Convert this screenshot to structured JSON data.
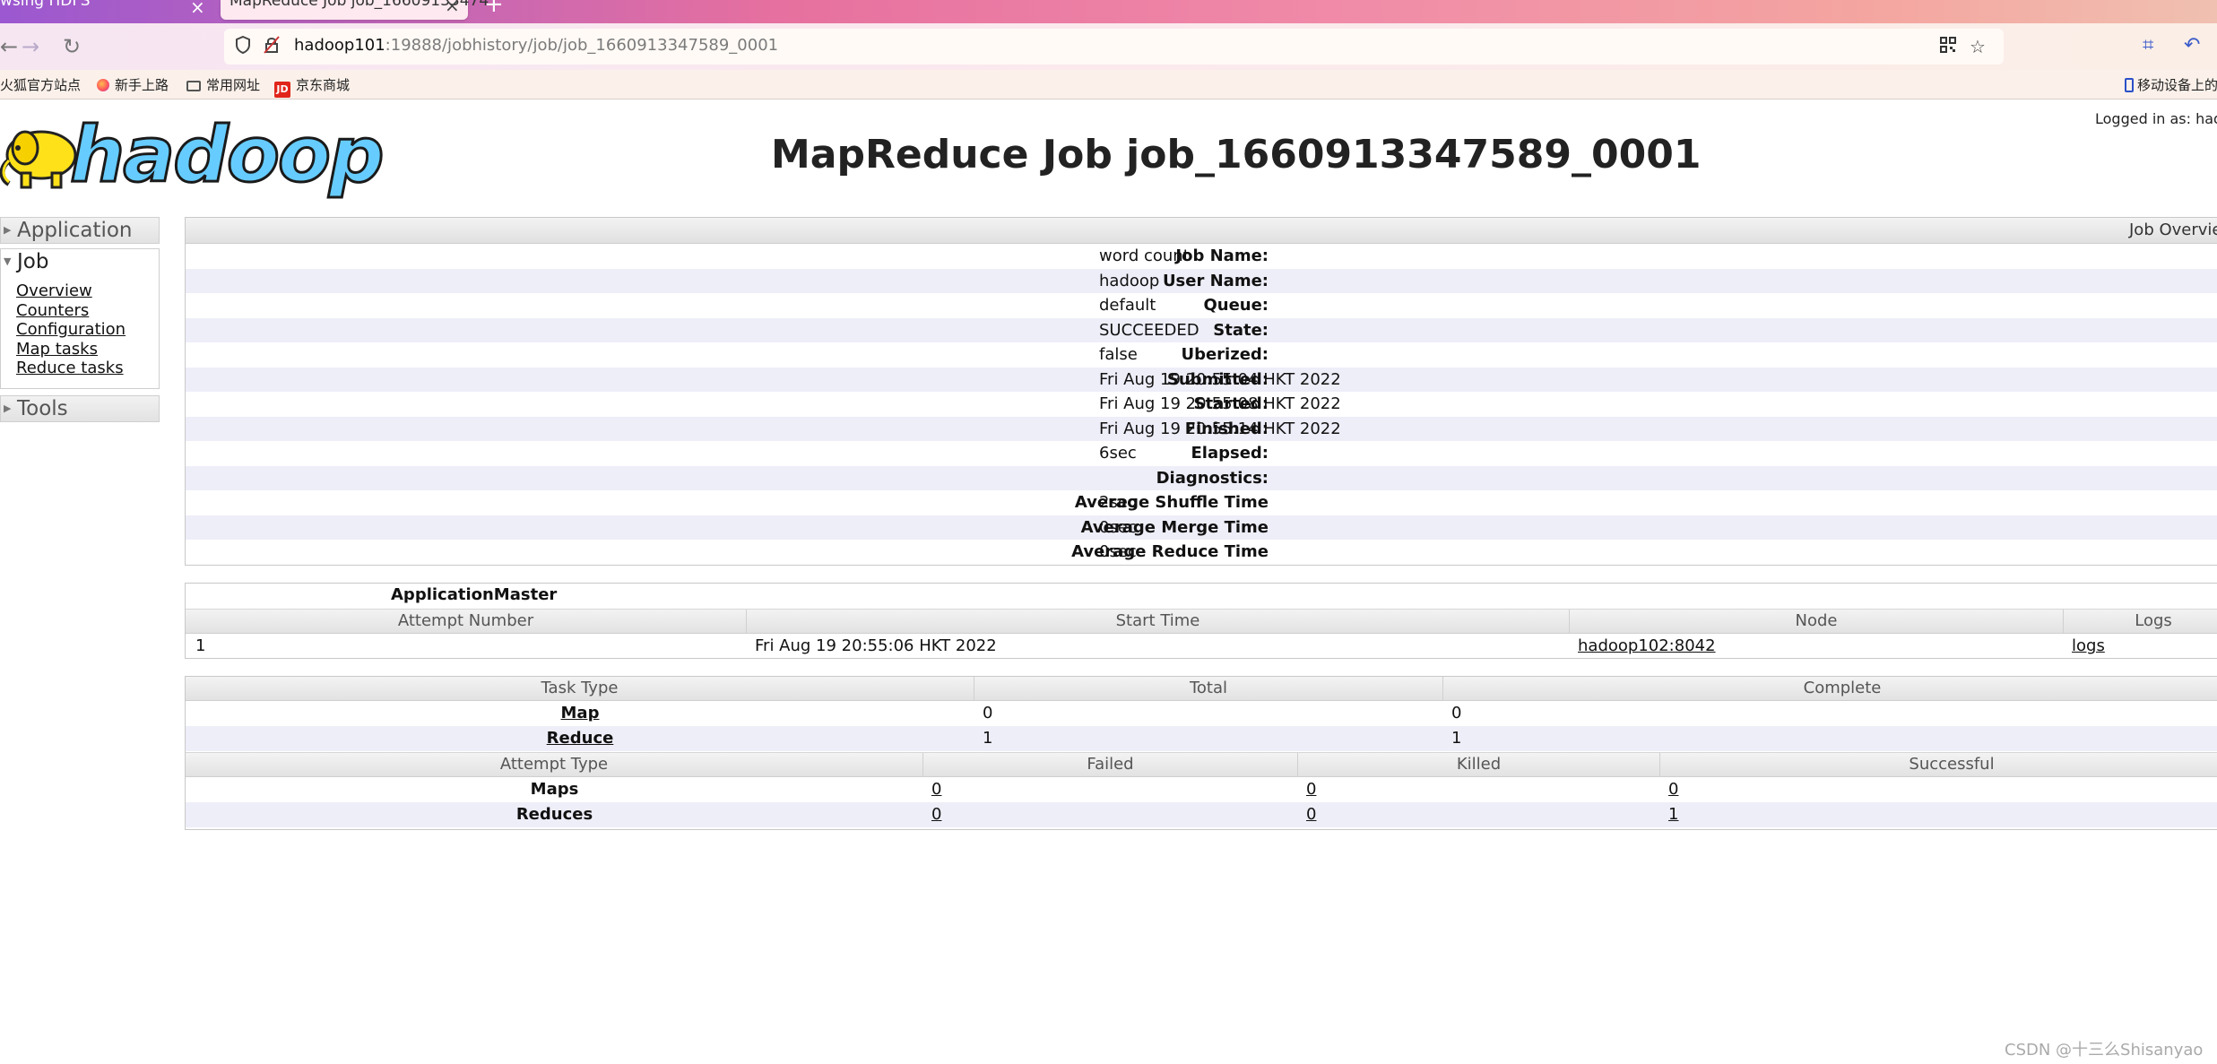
{
  "browser": {
    "prev_tab_label": "wsing HDFS",
    "active_tab_label": "MapReduce Job job_16609133474",
    "url_host": "hadoop101",
    "url_path": ":19888/jobhistory/job/job_1660913347589_0001",
    "bookmarks": [
      "火狐官方站点",
      "新手上路",
      "常用网址",
      "京东商城"
    ],
    "bookmark_right": "移动设备上的"
  },
  "header": {
    "logo_text": "hadoop",
    "title": "MapReduce Job job_1660913347589_0001",
    "logged_in": "Logged in as: had"
  },
  "sidebar": {
    "application": "Application",
    "job": "Job",
    "job_links": [
      "Overview",
      "Counters",
      "Configuration",
      "Map tasks",
      "Reduce tasks"
    ],
    "tools": "Tools"
  },
  "overview": {
    "heading": "Job Overvie",
    "rows": [
      {
        "key": "Job Name:",
        "value": "word count"
      },
      {
        "key": "User Name:",
        "value": "hadoop"
      },
      {
        "key": "Queue:",
        "value": "default"
      },
      {
        "key": "State:",
        "value": "SUCCEEDED"
      },
      {
        "key": "Uberized:",
        "value": "false"
      },
      {
        "key": "Submitted:",
        "value": "Fri Aug 19 20:55:04 HKT 2022"
      },
      {
        "key": "Started:",
        "value": "Fri Aug 19 20:55:08 HKT 2022"
      },
      {
        "key": "Finished:",
        "value": "Fri Aug 19 20:55:14 HKT 2022"
      },
      {
        "key": "Elapsed:",
        "value": "6sec"
      },
      {
        "key": "Diagnostics:",
        "value": ""
      },
      {
        "key": "Average Shuffle Time",
        "value": "2sec"
      },
      {
        "key": "Average Merge Time",
        "value": "0sec"
      },
      {
        "key": "Average Reduce Time",
        "value": "0sec"
      }
    ]
  },
  "app_master": {
    "title": "ApplicationMaster",
    "headers": [
      "Attempt Number",
      "Start Time",
      "Node",
      "Logs"
    ],
    "row": {
      "attempt": "1",
      "start_time": "Fri Aug 19 20:55:06 HKT 2022",
      "node": "hadoop102:8042",
      "logs": "logs"
    }
  },
  "tasks": {
    "headers": [
      "Task Type",
      "Total",
      "Complete"
    ],
    "rows": [
      {
        "type": "Map",
        "total": "0",
        "complete": "0"
      },
      {
        "type": "Reduce",
        "total": "1",
        "complete": "1"
      }
    ],
    "attempt_headers": [
      "Attempt Type",
      "Failed",
      "Killed",
      "Successful"
    ],
    "attempt_rows": [
      {
        "type": "Maps",
        "failed": "0",
        "killed": "0",
        "successful": "0"
      },
      {
        "type": "Reduces",
        "failed": "0",
        "killed": "0",
        "successful": "1"
      }
    ]
  },
  "watermark": "CSDN @十三么Shisanyao"
}
